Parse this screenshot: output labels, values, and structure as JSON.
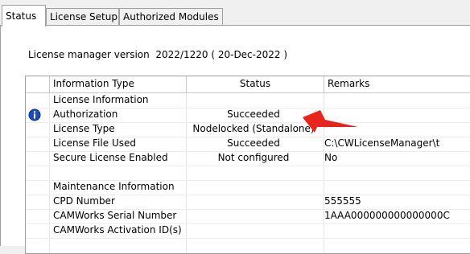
{
  "tabs": [
    {
      "label": "Status",
      "active": true
    },
    {
      "label": "License Setup",
      "active": false
    },
    {
      "label": "Authorized Modules",
      "active": false
    }
  ],
  "version_label": "License manager version",
  "version_value": "2022/1220 ( 20-Dec-2022 )",
  "grid": {
    "columns": [
      "Information Type",
      "Status",
      "Remarks"
    ],
    "rows": [
      {
        "type": "License Information",
        "status": "",
        "remarks": "",
        "icon": ""
      },
      {
        "type": "Authorization",
        "status": "Succeeded",
        "remarks": "",
        "icon": "info-icon"
      },
      {
        "type": "License Type",
        "status": "Nodelocked (Standalone)",
        "remarks": "",
        "icon": ""
      },
      {
        "type": "License File Used",
        "status": "Succeeded",
        "remarks": "C:\\CWLicenseManager\\t",
        "icon": ""
      },
      {
        "type": "Secure License Enabled",
        "status": "Not configured",
        "remarks": "No",
        "icon": ""
      },
      {
        "type": "",
        "status": "",
        "remarks": "",
        "icon": ""
      },
      {
        "type": "Maintenance Information",
        "status": "",
        "remarks": "",
        "icon": ""
      },
      {
        "type": "CPD Number",
        "status": "",
        "remarks": "555555",
        "icon": ""
      },
      {
        "type": "CAMWorks Serial Number",
        "status": "",
        "remarks": "1AAA000000000000000C",
        "icon": ""
      },
      {
        "type": "CAMWorks Activation ID(s)",
        "status": "",
        "remarks": "",
        "icon": ""
      }
    ]
  },
  "colors": {
    "annotation_arrow": "#e8241c",
    "info_icon": "#1c4fb5"
  }
}
